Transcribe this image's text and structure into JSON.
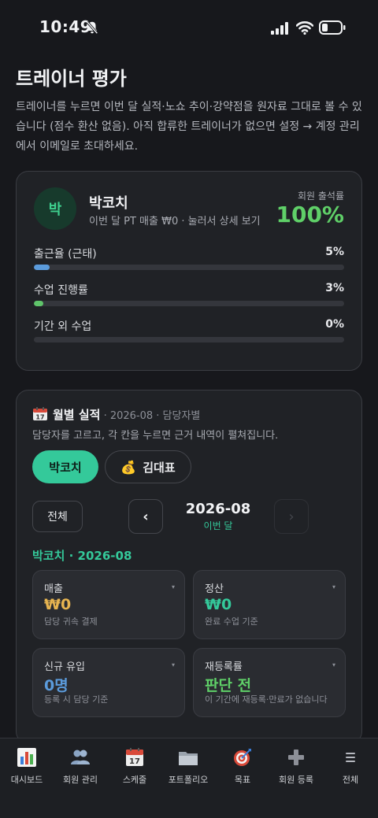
{
  "status_bar": {
    "time": "10:49"
  },
  "header": {
    "title": "트레이너 평가",
    "description": "트레이너를 누르면 이번 달 실적·노쇼 추이·강약점을 원자료 그대로 볼 수 있습니다 (점수 환산 없음). 아직 합류한 트레이너가 없으면 설정 → 계정 관리에서 이메일로 초대하세요."
  },
  "trainer_card": {
    "avatar": "박",
    "name": "박코치",
    "subtitle": "이번 달 PT 매출 ₩0 · 눌러서 상세 보기",
    "attendance_label": "회원 출석률",
    "attendance_value": "100%",
    "metrics": [
      {
        "label": "출근율 (근태)",
        "value": "5%",
        "fraction": 0.05,
        "color": "#5b9bdb"
      },
      {
        "label": "수업 진행률",
        "value": "3%",
        "fraction": 0.03,
        "color": "#5fc46a"
      },
      {
        "label": "기간 외 수업",
        "value": "0%",
        "fraction": 0.0,
        "color": "#5fc46a"
      }
    ]
  },
  "monthly": {
    "title": "월별 실적",
    "meta": " · 2026-08 · 담당자별",
    "description": "담당자를 고르고, 각 칸을 누르면 근거 내역이 펼쳐집니다.",
    "chips": [
      {
        "label": "박코치",
        "active": true
      },
      {
        "label": "김대표",
        "icon": "💰",
        "active": false
      }
    ],
    "all_button": "전체",
    "prev_symbol": "‹",
    "next_symbol": "›",
    "period": "2026-08",
    "period_sub": "이번 달",
    "section_label": "박코치 · 2026-08",
    "stats": [
      {
        "title": "매출",
        "value": "₩0",
        "note": "담당 귀속 결제",
        "color": "#e6b450"
      },
      {
        "title": "정산",
        "value": "₩0",
        "note": "완료 수업 기준",
        "color": "#34c99a"
      },
      {
        "title": "신규 유입",
        "value": "0명",
        "note": "등록 시 담당 기준",
        "color": "#5b9bdb"
      },
      {
        "title": "재등록률",
        "value": "판단 전",
        "note": "이 기간에 재등록·만료가 없습니다",
        "color": "#5fd068"
      }
    ],
    "caret": "▾"
  },
  "tabbar": [
    {
      "label": "대시보드",
      "icon": "bar-chart-icon"
    },
    {
      "label": "회원 관리",
      "icon": "people-icon"
    },
    {
      "label": "스케줄",
      "icon": "calendar-icon"
    },
    {
      "label": "포트폴리오",
      "icon": "folder-icon"
    },
    {
      "label": "목표",
      "icon": "target-icon"
    },
    {
      "label": "회원 등록",
      "icon": "plus-icon"
    },
    {
      "label": "전체",
      "icon": "menu-icon"
    }
  ]
}
